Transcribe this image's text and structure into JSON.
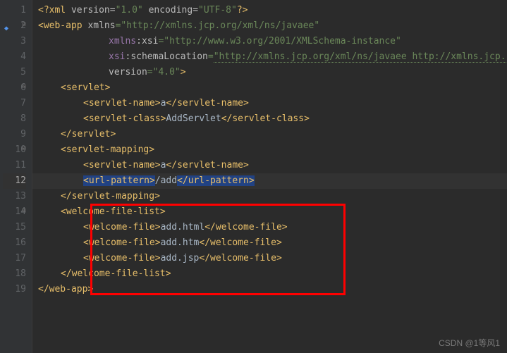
{
  "watermark": "CSDN @1等风1",
  "gutter": [
    {
      "n": "1",
      "fold": false,
      "hl": false,
      "bookmark": false
    },
    {
      "n": "2",
      "fold": true,
      "hl": false,
      "bookmark": true
    },
    {
      "n": "3",
      "fold": false,
      "hl": false,
      "bookmark": false
    },
    {
      "n": "4",
      "fold": false,
      "hl": false,
      "bookmark": false
    },
    {
      "n": "5",
      "fold": false,
      "hl": false,
      "bookmark": false
    },
    {
      "n": "6",
      "fold": true,
      "hl": false,
      "bookmark": false
    },
    {
      "n": "7",
      "fold": false,
      "hl": false,
      "bookmark": false
    },
    {
      "n": "8",
      "fold": false,
      "hl": false,
      "bookmark": false
    },
    {
      "n": "9",
      "fold": false,
      "hl": false,
      "bookmark": false
    },
    {
      "n": "10",
      "fold": true,
      "hl": false,
      "bookmark": false
    },
    {
      "n": "11",
      "fold": false,
      "hl": false,
      "bookmark": false
    },
    {
      "n": "12",
      "fold": false,
      "hl": true,
      "bookmark": false
    },
    {
      "n": "13",
      "fold": false,
      "hl": false,
      "bookmark": false
    },
    {
      "n": "14",
      "fold": true,
      "hl": false,
      "bookmark": false
    },
    {
      "n": "15",
      "fold": false,
      "hl": false,
      "bookmark": false
    },
    {
      "n": "16",
      "fold": false,
      "hl": false,
      "bookmark": false
    },
    {
      "n": "17",
      "fold": false,
      "hl": false,
      "bookmark": false
    },
    {
      "n": "18",
      "fold": false,
      "hl": false,
      "bookmark": false
    },
    {
      "n": "19",
      "fold": false,
      "hl": false,
      "bookmark": false
    }
  ],
  "code": {
    "l1": {
      "pi_open": "<?",
      "pi_name": "xml ",
      "a1": "version",
      "v1": "\"1.0\"",
      "a2": "encoding",
      "v2": "\"UTF-8\"",
      "pi_close": "?>"
    },
    "l2": {
      "open": "<",
      "tag": "web-app ",
      "a1": "xmlns",
      "eq": "=",
      "v1": "\"http://xmlns.jcp.org/xml/ns/javaee\""
    },
    "l3": {
      "ns1": "xmlns",
      "colon": ":",
      "ns2": "xsi",
      "eq": "=",
      "v": "\"http://www.w3.org/2001/XMLSchema-instance\""
    },
    "l4": {
      "ns1": "xsi",
      "colon": ":",
      "a": "schemaLocation",
      "eq": "=",
      "v": "\"http://xmlns.jcp.org/xml/ns/javaee http://xmlns.jcp."
    },
    "l5": {
      "a": "version",
      "eq": "=",
      "v": "\"4.0\"",
      "close": ">"
    },
    "l6": {
      "open": "<",
      "tag": "servlet",
      "close": ">"
    },
    "l7": {
      "open": "<",
      "tag": "servlet-name",
      "close": ">",
      "txt": "a",
      "copen": "</",
      "ctag": "servlet-name",
      "cclose": ">"
    },
    "l8": {
      "open": "<",
      "tag": "servlet-class",
      "close": ">",
      "txt": "AddServlet",
      "copen": "</",
      "ctag": "servlet-class",
      "cclose": ">"
    },
    "l9": {
      "copen": "</",
      "ctag": "servlet",
      "cclose": ">"
    },
    "l10": {
      "open": "<",
      "tag": "servlet-mapping",
      "close": ">"
    },
    "l11": {
      "open": "<",
      "tag": "servlet-name",
      "close": ">",
      "txt": "a",
      "copen": "</",
      "ctag": "servlet-name",
      "cclose": ">"
    },
    "l12": {
      "open": "<",
      "tag": "url-pattern",
      "close": ">",
      "txt": "/add",
      "copen": "</",
      "ctag": "url-pattern",
      "cclose": ">"
    },
    "l13": {
      "copen": "</",
      "ctag": "servlet-mapping",
      "cclose": ">"
    },
    "l14": {
      "open": "<",
      "tag": "welcome-file-list",
      "close": ">"
    },
    "l15": {
      "open": "<",
      "tag": "welcome-file",
      "close": ">",
      "txt": "add.html",
      "copen": "</",
      "ctag": "welcome-file",
      "cclose": ">"
    },
    "l16": {
      "open": "<",
      "tag": "welcome-file",
      "close": ">",
      "txt": "add.htm",
      "copen": "</",
      "ctag": "welcome-file",
      "cclose": ">"
    },
    "l17": {
      "open": "<",
      "tag": "welcome-file",
      "close": ">",
      "txt": "add.jsp",
      "copen": "</",
      "ctag": "welcome-file",
      "cclose": ">"
    },
    "l18": {
      "copen": "</",
      "ctag": "welcome-file-list",
      "cclose": ">"
    },
    "l19": {
      "copen": "</",
      "ctag": "web-app",
      "cclose": ">"
    }
  }
}
